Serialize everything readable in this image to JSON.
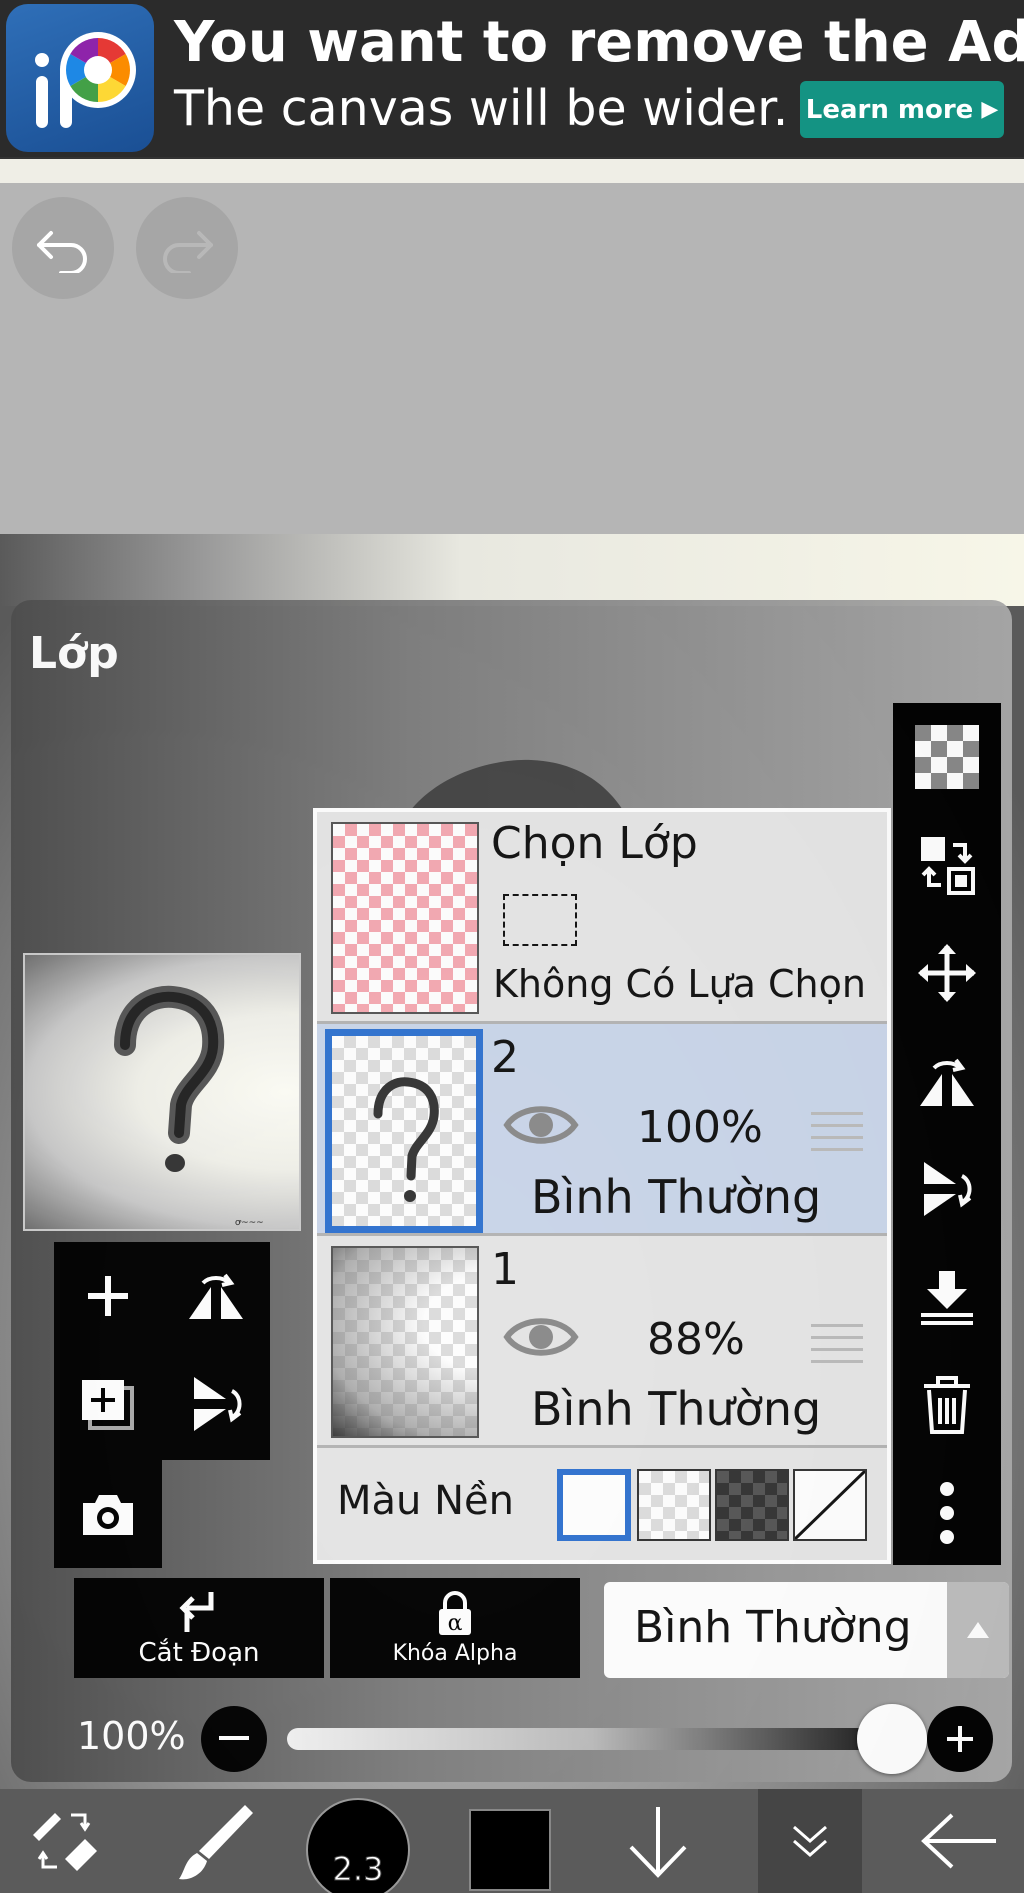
{
  "ad": {
    "title": "You want to remove the Ad?",
    "subtitle": "The canvas will be wider.",
    "button_label": "Learn more",
    "button_color": "#149383"
  },
  "history": {
    "undo_icon": "undo-icon",
    "redo_icon": "redo-icon"
  },
  "layer_panel": {
    "title": "Lớp",
    "selection_row": {
      "title": "Chọn Lớp",
      "status": "Không Có Lựa Chọn"
    },
    "layers": [
      {
        "name": "2",
        "opacity": "100%",
        "blend_mode": "Bình Thường",
        "selected": true
      },
      {
        "name": "1",
        "opacity": "88%",
        "blend_mode": "Bình Thường",
        "selected": false
      }
    ],
    "background_row": {
      "label": "Màu Nền",
      "options": [
        "white",
        "transparent",
        "dark-checker",
        "none"
      ],
      "selected": "white"
    },
    "clipping_label": "Cắt Đoạn",
    "alpha_lock_label": "Khóa Alpha",
    "blend_mode_value": "Bình Thường",
    "opacity_value": "100%",
    "opacity_fraction": 1.0,
    "selection_color": "#2f72d0"
  },
  "bottom_toolbar": {
    "brush_size": "2.3",
    "current_color": "#000000"
  }
}
